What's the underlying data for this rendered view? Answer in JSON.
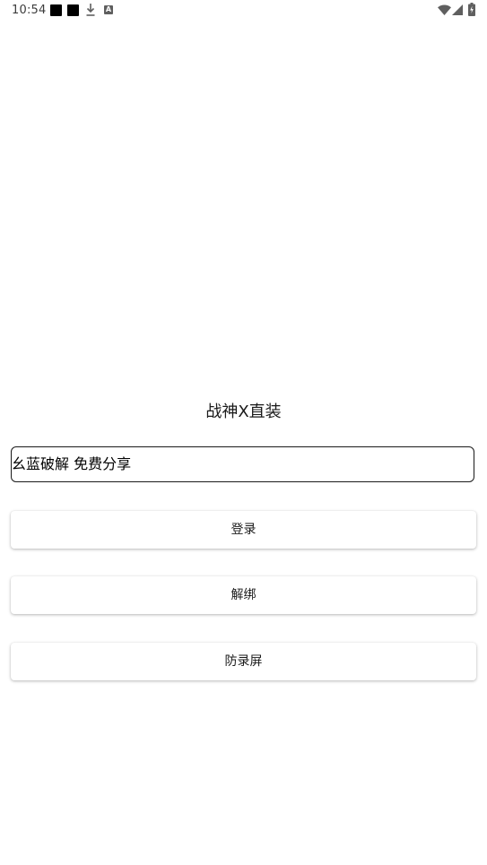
{
  "status_bar": {
    "time": "10:54",
    "notification_badge": "A",
    "icons": [
      "notification-square-icon",
      "notification-square-icon",
      "download-icon",
      "a-badge-icon",
      "wifi-icon",
      "cellular-signal-icon",
      "battery-charging-icon"
    ]
  },
  "app": {
    "title": "战神X直装"
  },
  "input": {
    "value": "幺蓝破解 免费分享",
    "placeholder": ""
  },
  "buttons": {
    "login_label": "登录",
    "unbind_label": "解绑",
    "anti_record_label": "防录屏"
  },
  "colors": {
    "background": "#ffffff",
    "text": "#1a1a1a",
    "input_border": "#1a1a1a"
  }
}
